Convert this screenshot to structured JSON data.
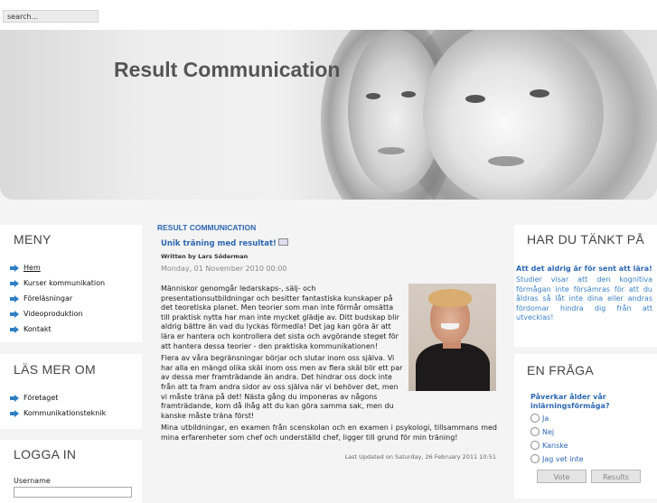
{
  "search": {
    "placeholder": "search..."
  },
  "header": {
    "site_title": "Result Communication"
  },
  "menu": {
    "title": "MENY",
    "items": [
      {
        "label": "Hem"
      },
      {
        "label": "Kurser kommunikation"
      },
      {
        "label": "Föreläsningar"
      },
      {
        "label": "Videoproduktion"
      },
      {
        "label": "Kontakt"
      }
    ]
  },
  "read_more": {
    "title": "LÄS MER OM",
    "items": [
      {
        "label": "Företaget"
      },
      {
        "label": "Kommunikationsteknik"
      }
    ]
  },
  "login": {
    "title": "LOGGA IN",
    "username_label": "Username"
  },
  "main": {
    "section_title": "RESULT COMMUNICATION",
    "article_title": "Unik träning med resultat!",
    "author": "Written by Lars Söderman",
    "date": "Monday, 01 November 2010 00:00",
    "paragraphs": [
      "Människor genomgår ledarskaps-, sälj- och presentationsutbildningar och besitter fantastiska kunskaper på det teoretiska planet. Men teorier som man inte förmår omsätta till praktisk nytta har man inte mycket glädje av. Ditt budskap blir aldrig bättre än vad du lyckas förmedla! Det jag kan göra är att lära er hantera och kontrollera det sista och avgörande steget för att hantera dessa teorier - den praktiska kommunikationen!",
      "Flera av våra begränsningar börjar och slutar inom oss själva. Vi har alla en mängd olika skäl inom oss men av flera skäl blir ett par av dessa mer framträdande än andra. Det hindrar oss dock inte från att ta fram andra sidor av oss själva när vi behöver det, men vi måste träna på det! Nästa gång du imponeras av någons framträdande, kom då ihåg att du kan göra samma sak, men du kanske måste träna först!",
      "Mina utbildningar, en examen från scenskolan och en examen i psykologi, tillsammans med mina erfarenheter som chef och underställd chef, ligger till grund för min träning!"
    ],
    "updated": "Last Updated on Saturday, 26 February 2011 10:51"
  },
  "think": {
    "title": "HAR DU TÄNKT PÅ",
    "question": "Att det aldrig är för sent att lära!",
    "text": "Studier visar att den kognitiva förmågan inte försämras för att du åldras så låt inte dina eller andras fördomar hindra dig från att utvecklas!"
  },
  "poll": {
    "title": "EN FRÅGA",
    "question": "Påverkar ålder vår inlärningsförmåga?",
    "options": [
      "Ja",
      "Nej",
      "Kanske",
      "Jag vet inte"
    ],
    "vote_label": "Vote",
    "results_label": "Results"
  }
}
